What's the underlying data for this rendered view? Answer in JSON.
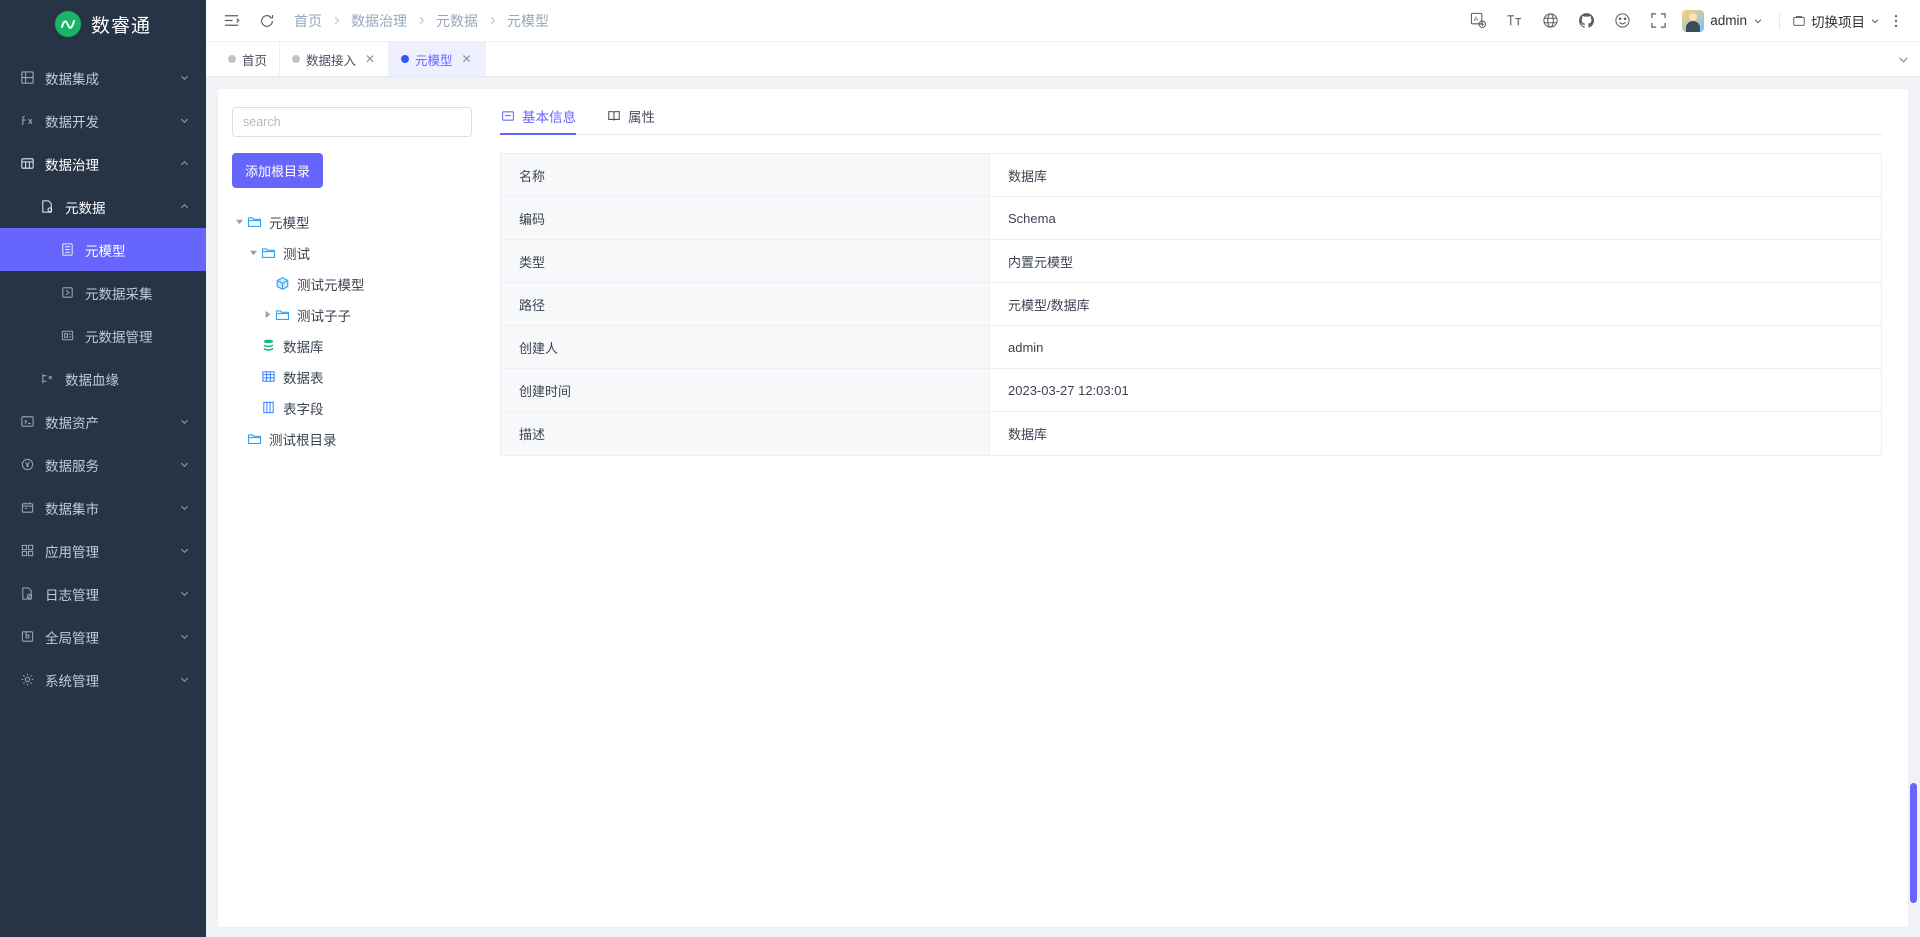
{
  "app": {
    "logo_text": "数睿通",
    "logo_glyph": "∿"
  },
  "sidebar": {
    "items": [
      {
        "label": "数据集成",
        "icon": "grid-box-icon",
        "level": 1,
        "arrow": "down",
        "state": "normal"
      },
      {
        "label": "数据开发",
        "icon": "fx-icon",
        "level": 1,
        "arrow": "down",
        "state": "normal"
      },
      {
        "label": "数据治理",
        "icon": "table-icon",
        "level": 1,
        "arrow": "up",
        "state": "expanded"
      },
      {
        "label": "元数据",
        "icon": "metadata-icon",
        "level": 2,
        "arrow": "up",
        "state": "expanded"
      },
      {
        "label": "元模型",
        "icon": "model-icon",
        "level": 3,
        "arrow": "none",
        "state": "active"
      },
      {
        "label": "元数据采集",
        "icon": "collect-icon",
        "level": 3,
        "arrow": "none",
        "state": "normal"
      },
      {
        "label": "元数据管理",
        "icon": "manage-icon",
        "level": 3,
        "arrow": "none",
        "state": "normal"
      },
      {
        "label": "数据血缘",
        "icon": "lineage-icon",
        "level": 2,
        "arrow": "none",
        "state": "normal"
      },
      {
        "label": "数据资产",
        "icon": "asset-icon",
        "level": 1,
        "arrow": "down",
        "state": "normal"
      },
      {
        "label": "数据服务",
        "icon": "service-icon",
        "level": 1,
        "arrow": "down",
        "state": "normal"
      },
      {
        "label": "数据集市",
        "icon": "market-icon",
        "level": 1,
        "arrow": "down",
        "state": "normal"
      },
      {
        "label": "应用管理",
        "icon": "apps-icon",
        "level": 1,
        "arrow": "down",
        "state": "normal"
      },
      {
        "label": "日志管理",
        "icon": "log-icon",
        "level": 1,
        "arrow": "down",
        "state": "normal"
      },
      {
        "label": "全局管理",
        "icon": "global-icon",
        "level": 1,
        "arrow": "down",
        "state": "normal"
      },
      {
        "label": "系统管理",
        "icon": "gear-icon",
        "level": 1,
        "arrow": "down",
        "state": "normal"
      }
    ]
  },
  "header": {
    "collapse_icon": "menu-fold-icon",
    "refresh_icon": "refresh-icon",
    "breadcrumb": [
      "首页",
      "数据治理",
      "元数据",
      "元模型"
    ],
    "right_icons": [
      {
        "name": "translate-icon",
        "glyph": "译"
      },
      {
        "name": "font-size-icon",
        "glyph": "Tт"
      },
      {
        "name": "globe-icon",
        "glyph": "globe"
      },
      {
        "name": "github-icon",
        "glyph": "github"
      },
      {
        "name": "emoji-icon",
        "glyph": "smiley"
      },
      {
        "name": "fullscreen-icon",
        "glyph": "expand"
      }
    ],
    "user_name": "admin",
    "project_switch_label": "切换项目",
    "more_icon": "more-vertical-icon"
  },
  "tabbar": {
    "tabs": [
      {
        "label": "首页",
        "closable": false,
        "active": false
      },
      {
        "label": "数据接入",
        "closable": true,
        "active": false
      },
      {
        "label": "元模型",
        "closable": true,
        "active": true
      }
    ],
    "close_glyph": "✕",
    "collapse_glyph": "⌄"
  },
  "tree_panel": {
    "search_placeholder": "search",
    "search_value": "",
    "add_root_label": "添加根目录",
    "nodes": [
      {
        "label": "元模型",
        "icon": "folder-icon",
        "indent": 0,
        "caret": "expanded"
      },
      {
        "label": "测试",
        "icon": "folder-icon",
        "indent": 1,
        "caret": "expanded"
      },
      {
        "label": "测试元模型",
        "icon": "cube-icon",
        "indent": 2,
        "caret": "none"
      },
      {
        "label": "测试子子",
        "icon": "folder-icon",
        "indent": 2,
        "caret": "collapsed"
      },
      {
        "label": "数据库",
        "icon": "database-icon",
        "indent": 1,
        "caret": "none"
      },
      {
        "label": "数据表",
        "icon": "grid-table-icon",
        "indent": 1,
        "caret": "none"
      },
      {
        "label": "表字段",
        "icon": "column-icon",
        "indent": 1,
        "caret": "none"
      },
      {
        "label": "测试根目录",
        "icon": "folder-icon",
        "indent": 0,
        "caret": "none"
      }
    ]
  },
  "detail": {
    "tabs": [
      {
        "label": "基本信息",
        "icon": "info-card-icon",
        "active": true
      },
      {
        "label": "属性",
        "icon": "book-icon",
        "active": false
      }
    ],
    "rows": [
      {
        "label": "名称",
        "value": "数据库"
      },
      {
        "label": "编码",
        "value": "Schema"
      },
      {
        "label": "类型",
        "value": "内置元模型"
      },
      {
        "label": "路径",
        "value": "元模型/数据库"
      },
      {
        "label": "创建人",
        "value": "admin"
      },
      {
        "label": "创建时间",
        "value": "2023-03-27 12:03:01"
      },
      {
        "label": "描述",
        "value": "数据库"
      }
    ]
  },
  "colors": {
    "sidebar_bg": "#263445",
    "accent": "#6666ff",
    "logo_green": "#18b566",
    "tab_active_bg": "#eef0ff"
  }
}
